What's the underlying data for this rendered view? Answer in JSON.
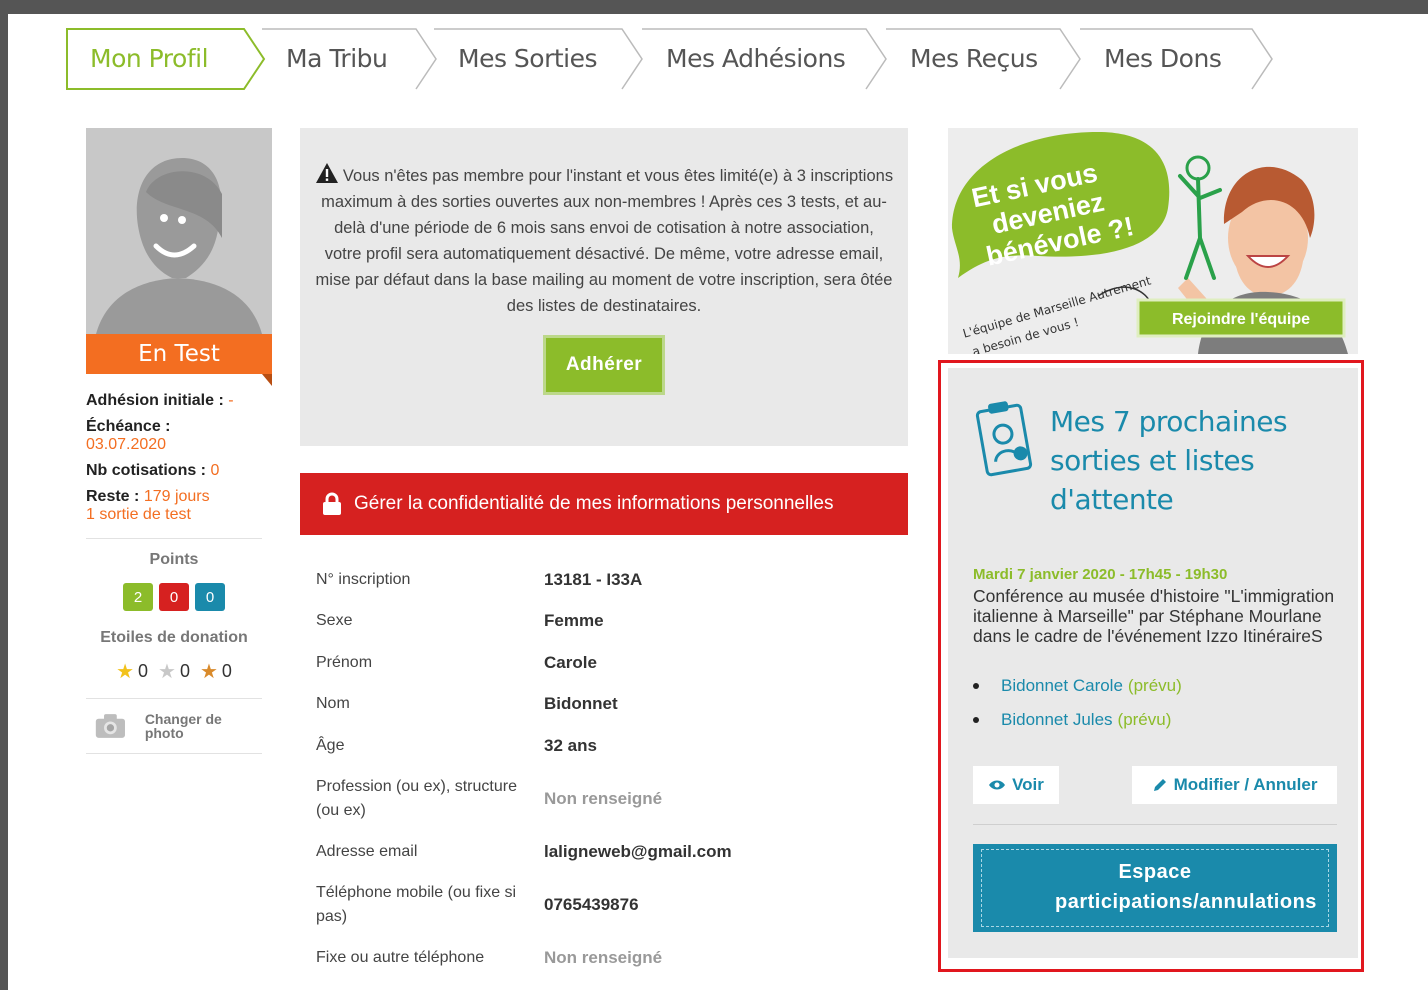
{
  "tabs": [
    {
      "label": "Mon Profil",
      "active": true
    },
    {
      "label": "Ma Tribu"
    },
    {
      "label": "Mes Sorties"
    },
    {
      "label": "Mes Adhésions"
    },
    {
      "label": "Mes Reçus"
    },
    {
      "label": "Mes Dons"
    }
  ],
  "profile": {
    "status": "En Test",
    "adhesion_label": "Adhésion initiale :",
    "adhesion_value": "-",
    "echeance_label": "Échéance :",
    "echeance_value": "03.07.2020",
    "cotisations_label": "Nb cotisations :",
    "cotisations_value": "0",
    "reste_label": "Reste :",
    "reste_value": "179 jours",
    "reste_extra": "1 sortie de test",
    "points_title": "Points",
    "points": [
      "2",
      "0",
      "0"
    ],
    "points_colors": [
      "#8cbc2a",
      "#d62120",
      "#1a8aab"
    ],
    "stars_title": "Etoiles de donation",
    "stars": [
      "0",
      "0",
      "0"
    ],
    "star_colors": [
      "#f2c21b",
      "#c8c8c8",
      "#d98a2b"
    ],
    "change_photo": "Changer de photo"
  },
  "notice": {
    "text": "Vous n'êtes pas membre pour l'instant et vous êtes limité(e) à 3 inscriptions maximum à des sorties ouvertes aux non-membres ! Après ces 3 tests, et au-delà d'une période de 6 mois sans envoi de cotisation à notre association, votre profil sera automatiquement désactivé. De même, votre adresse email, mise par défaut dans la base mailing au moment de votre inscription, sera ôtée des listes de destinataires.",
    "button": "Adhérer"
  },
  "privacy": {
    "label": "Gérer la confidentialité de mes informations personnelles"
  },
  "details": [
    {
      "label": "N° inscription",
      "value": "13181 - I33A"
    },
    {
      "label": "Sexe",
      "value": "Femme"
    },
    {
      "label": "Prénom",
      "value": "Carole"
    },
    {
      "label": "Nom",
      "value": "Bidonnet"
    },
    {
      "label": "Âge",
      "value": "32 ans"
    },
    {
      "label": "Profession (ou ex), structure (ou ex)",
      "value": "Non renseigné"
    },
    {
      "label": "Adresse email",
      "value": "laligneweb@gmail.com"
    },
    {
      "label": "Téléphone mobile (ou fixe si pas)",
      "value": "0765439876"
    },
    {
      "label": "Fixe ou autre téléphone",
      "value": "Non renseigné"
    }
  ],
  "promo": {
    "headline": [
      "Et si vous",
      "deveniez",
      "bénévole ?!"
    ],
    "tagline": [
      "L'équipe de Marseille Autrement",
      "a besoin de vous !"
    ],
    "button": "Rejoindre l'équipe"
  },
  "outings": {
    "title": "Mes 7 prochaines sorties et listes d'attente",
    "event_date": "Mardi 7 janvier 2020 - 17h45 - 19h30",
    "event_desc": "Conférence au musée d'histoire \"L'immigration italienne à Marseille\" par Stéphane Mourlane dans le cadre de l'événement Izzo ItinéraireS",
    "attendees": [
      {
        "name": "Bidonnet Carole",
        "status": "(prévu)"
      },
      {
        "name": "Bidonnet Jules",
        "status": "(prévu)"
      }
    ],
    "view_button": "Voir",
    "edit_button": "Modifier / Annuler",
    "space_button": "Espace participations/annulations"
  }
}
